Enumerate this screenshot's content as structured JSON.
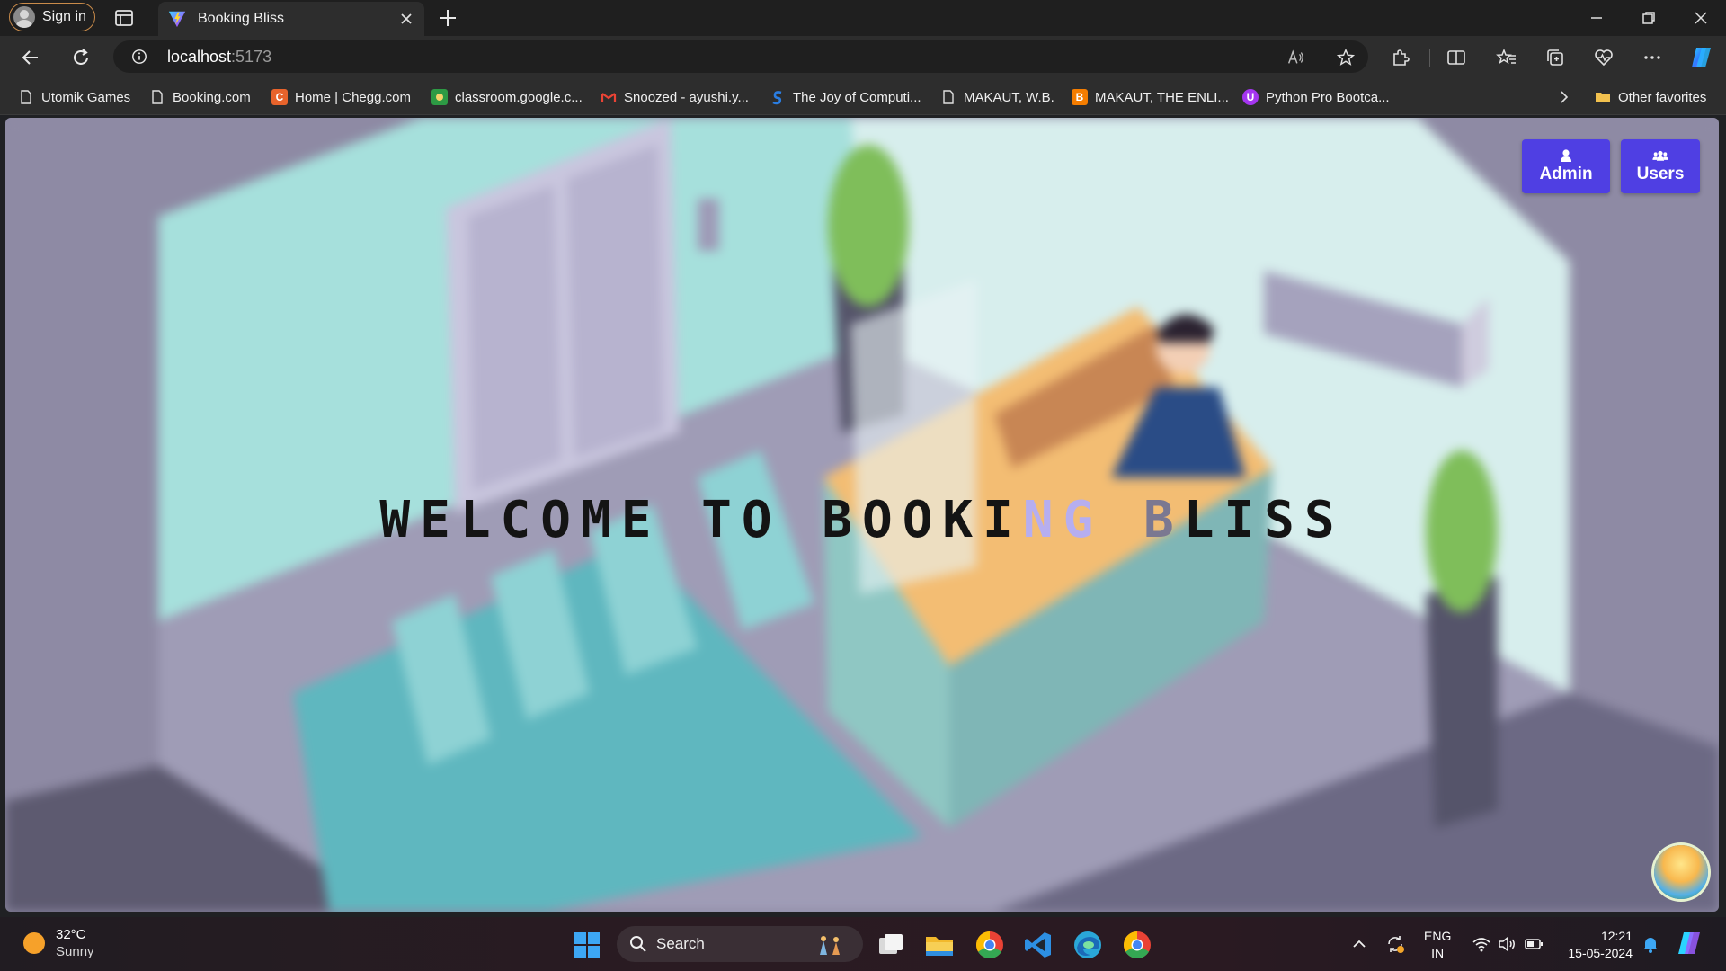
{
  "browser": {
    "sign_in_label": "Sign in",
    "tab_title": "Booking Bliss",
    "url_host": "localhost",
    "url_port": ":5173",
    "other_favorites": "Other favorites"
  },
  "bookmarks": [
    {
      "label": "Utomik Games",
      "icon": "page-icon"
    },
    {
      "label": "Booking.com",
      "icon": "page-icon"
    },
    {
      "label": "Home | Chegg.com",
      "icon": "chegg-icon"
    },
    {
      "label": "classroom.google.c...",
      "icon": "classroom-icon"
    },
    {
      "label": "Snoozed - ayushi.y...",
      "icon": "gmail-icon"
    },
    {
      "label": "The Joy of Computi...",
      "icon": "swayam-icon"
    },
    {
      "label": "MAKAUT, W.B.",
      "icon": "page-icon"
    },
    {
      "label": "MAKAUT, THE ENLI...",
      "icon": "blogger-icon"
    },
    {
      "label": "Python Pro Bootca...",
      "icon": "udemy-icon"
    }
  ],
  "page": {
    "welcome_part1": "WELCOME TO BOOKI",
    "welcome_part2": "NG ",
    "welcome_part3": "B",
    "welcome_part4": "LISS",
    "admin_label": "Admin",
    "users_label": "Users",
    "accent_color": "#4f3fe3"
  },
  "taskbar": {
    "temperature": "32°C",
    "condition": "Sunny",
    "search_placeholder": "Search",
    "lang_line1": "ENG",
    "lang_line2": "IN",
    "time": "12:21",
    "date": "15-05-2024"
  }
}
